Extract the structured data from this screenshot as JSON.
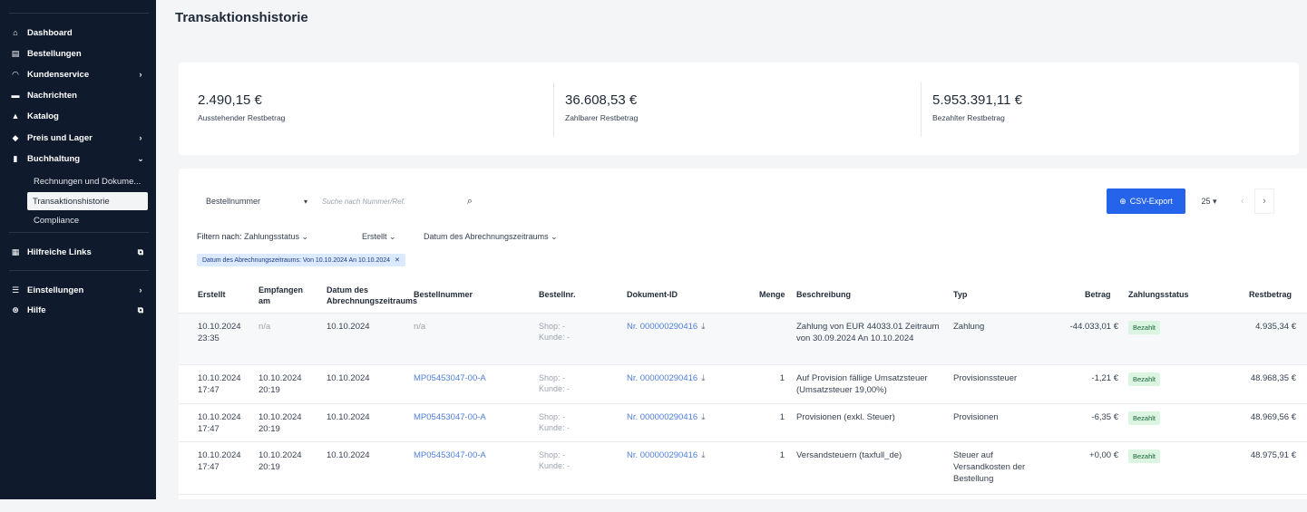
{
  "sidebar": {
    "items": [
      {
        "icon": "home-icon",
        "glyph": "⌂",
        "label": "Dashboard"
      },
      {
        "icon": "orders-icon",
        "glyph": "▤",
        "label": "Bestellungen"
      },
      {
        "icon": "headset-icon",
        "glyph": "◠",
        "label": "Kundenservice",
        "chevron": "›"
      },
      {
        "icon": "message-icon",
        "glyph": "▬",
        "label": "Nachrichten"
      },
      {
        "icon": "catalog-icon",
        "glyph": "▲",
        "label": "Katalog"
      },
      {
        "icon": "tag-icon",
        "glyph": "◆",
        "label": "Preis und Lager",
        "chevron": "›"
      },
      {
        "icon": "ledger-icon",
        "glyph": "▮",
        "label": "Buchhaltung",
        "chevron": "⌄"
      }
    ],
    "sub_items": [
      "Rechnungen und Dokume...",
      "Transaktionshistorie",
      "Compliance"
    ],
    "links": {
      "label": "Hilfreiche Links",
      "glyph": "▦",
      "ext": "⧉"
    },
    "settings": {
      "label": "Einstellungen",
      "glyph": "☰",
      "chevron": "›"
    },
    "help": {
      "label": "Hilfe",
      "glyph": "⊛",
      "ext": "⧉"
    }
  },
  "page_title": "Transaktionshistorie",
  "stats": [
    {
      "amount": "2.490,15 €",
      "label": "Ausstehender Restbetrag"
    },
    {
      "amount": "36.608,53 €",
      "label": "Zahlbarer Restbetrag"
    },
    {
      "amount": "5.953.391,11 €",
      "label": "Bezahlter Restbetrag"
    }
  ],
  "search": {
    "select_value": "Bestellnummer",
    "select_caret": "▾",
    "placeholder": "Suche nach Nummer/Ref.",
    "icon": "⌕"
  },
  "toolbar": {
    "csv_label": "CSV-Export",
    "csv_glyph": "⊕",
    "per_page": "25 ▾",
    "prev": "‹",
    "next": "›"
  },
  "filters": {
    "label": "Filtern nach:",
    "options": [
      "Zahlungsstatus ⌄",
      "Erstellt ⌄",
      "Datum des Abrechnungszeitraums ⌄"
    ],
    "active_chip": "Datum des Abrechnungszeitraums: Von 10.10.2024 An 10.10.2024",
    "chip_close": "✕"
  },
  "table": {
    "headers": {
      "erstellt": "Erstellt",
      "empfangen": "Empfangen am",
      "datum": "Datum des Abrechnungszeitraums",
      "bestellnummer": "Bestellnummer",
      "bestellnr": "Bestellnr.",
      "dokument": "Dokument-ID",
      "menge": "Menge",
      "beschreibung": "Beschreibung",
      "typ": "Typ",
      "betrag": "Betrag",
      "zahlungsstatus": "Zahlungsstatus",
      "restbetrag": "Restbetrag"
    },
    "rows": [
      {
        "erstellt": "10.10.2024 23:35",
        "empfangen": "n/a",
        "datum": "10.10.2024",
        "bestellnummer": "n/a",
        "shop": "Shop:  -",
        "kunde": "Kunde:  -",
        "dokument": "Nr. 000000290416",
        "menge": "",
        "beschreibung": "Zahlung von EUR 44033.01 Zeitraum von 30.09.2024 An 10.10.2024",
        "typ": "Zahlung",
        "betrag": "-44.033,01 €",
        "status": "Bezahlt",
        "restbetrag": "4.935,34 €"
      },
      {
        "erstellt": "10.10.2024 17:47",
        "empfangen": "10.10.2024 20:19",
        "datum": "10.10.2024",
        "bestellnummer": "MP05453047-00-A",
        "shop": "Shop:  -",
        "kunde": "Kunde:  -",
        "dokument": "Nr. 000000290416",
        "menge": "1",
        "beschreibung": "Auf Provision fällige Umsatzsteuer (Umsatzsteuer 19,00%)",
        "typ": "Provisionssteuer",
        "betrag": "-1,21 €",
        "status": "Bezahlt",
        "restbetrag": "48.968,35 €"
      },
      {
        "erstellt": "10.10.2024 17:47",
        "empfangen": "10.10.2024 20:19",
        "datum": "10.10.2024",
        "bestellnummer": "MP05453047-00-A",
        "shop": "Shop:  -",
        "kunde": "Kunde:  -",
        "dokument": "Nr. 000000290416",
        "menge": "1",
        "beschreibung": "Provisionen (exkl. Steuer)",
        "typ": "Provisionen",
        "betrag": "-6,35 €",
        "status": "Bezahlt",
        "restbetrag": "48.969,56 €"
      },
      {
        "erstellt": "10.10.2024 17:47",
        "empfangen": "10.10.2024 20:19",
        "datum": "10.10.2024",
        "bestellnummer": "MP05453047-00-A",
        "shop": "Shop:  -",
        "kunde": "Kunde:  -",
        "dokument": "Nr. 000000290416",
        "menge": "1",
        "beschreibung": "Versandsteuern (taxfull_de)",
        "typ": "Steuer auf Versandkosten der Bestellung",
        "betrag": "+0,00 €",
        "status": "Bezahlt",
        "restbetrag": "48.975,91 €"
      }
    ],
    "download_glyph": "⤓"
  }
}
